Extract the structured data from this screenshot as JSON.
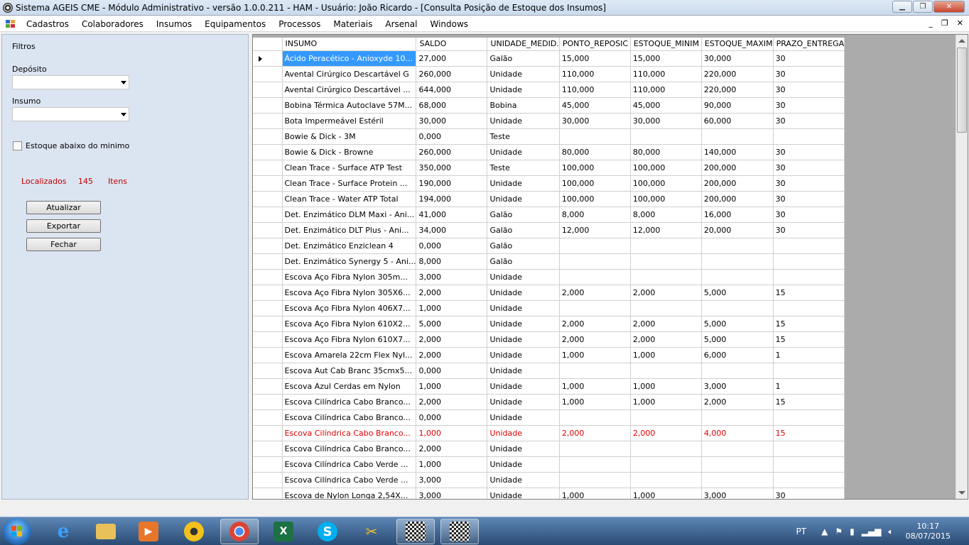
{
  "window": {
    "title": "Sistema AGEIS CME - Módulo Administrativo - versão 1.0.0.211 - HAM - Usuário: João Ricardo - [Consulta Posição de Estoque dos Insumos]",
    "min_icon": "minimize-icon",
    "max_icon": "restore-icon",
    "close_icon": "close-icon"
  },
  "menu": [
    "Cadastros",
    "Colaboradores",
    "Insumos",
    "Equipamentos",
    "Processos",
    "Materiais",
    "Arsenal",
    "Windows"
  ],
  "mdi_controls": [
    "_",
    "❐",
    "✕"
  ],
  "filters": {
    "title": "Filtros",
    "deposito_label": "Depósito",
    "deposito_value": "",
    "insumo_label": "Insumo",
    "insumo_value": "",
    "below_min_label": "Estoque abaixo do minimo",
    "below_min_checked": false,
    "found_label": "Localizados",
    "found_count": "145",
    "found_unit": "Itens",
    "buttons": {
      "update": "Atualizar",
      "export": "Exportar",
      "close": "Fechar"
    }
  },
  "grid": {
    "columns": [
      "INSUMO",
      "SALDO",
      "UNIDADE_MEDID.",
      "PONTO_REPOSIC",
      "ESTOQUE_MINIM",
      "ESTOQUE_MAXIM",
      "PRAZO_ENTREGA"
    ],
    "selected_row": 0,
    "highlight_color": "#e00000",
    "rows": [
      {
        "c": [
          "Ácido Peracético - Anioxyde 10...",
          "27,000",
          "Galão",
          "15,000",
          "15,000",
          "30,000",
          "30"
        ],
        "warn": false
      },
      {
        "c": [
          "Avental Cirúrgico Descartável  G",
          "260,000",
          "Unidade",
          "110,000",
          "110,000",
          "220,000",
          "30"
        ],
        "warn": false
      },
      {
        "c": [
          "Avental Cirúrgico Descartável ...",
          "644,000",
          "Unidade",
          "110,000",
          "110,000",
          "220,000",
          "30"
        ],
        "warn": false
      },
      {
        "c": [
          "Bobina Térmica Autoclave 57M...",
          "68,000",
          "Bobina",
          "45,000",
          "45,000",
          "90,000",
          "30"
        ],
        "warn": false
      },
      {
        "c": [
          "Bota Impermeável Estéril",
          "30,000",
          "Unidade",
          "30,000",
          "30,000",
          "60,000",
          "30"
        ],
        "warn": false
      },
      {
        "c": [
          "Bowie & Dick - 3M",
          "0,000",
          "Teste",
          "",
          "",
          "",
          ""
        ],
        "warn": false
      },
      {
        "c": [
          "Bowie & Dick - Browne",
          "260,000",
          "Unidade",
          "80,000",
          "80,000",
          "140,000",
          "30"
        ],
        "warn": false
      },
      {
        "c": [
          "Clean Trace - Surface ATP Test",
          "350,000",
          "Teste",
          "100,000",
          "100,000",
          "200,000",
          "30"
        ],
        "warn": false
      },
      {
        "c": [
          "Clean Trace - Surface Protein ...",
          "190,000",
          "Unidade",
          "100,000",
          "100,000",
          "200,000",
          "30"
        ],
        "warn": false
      },
      {
        "c": [
          "Clean Trace - Water ATP Total",
          "194,000",
          "Unidade",
          "100,000",
          "100,000",
          "200,000",
          "30"
        ],
        "warn": false
      },
      {
        "c": [
          "Det. Enzimático DLM Maxi - Ani...",
          "41,000",
          "Galão",
          "8,000",
          "8,000",
          "16,000",
          "30"
        ],
        "warn": false
      },
      {
        "c": [
          "Det. Enzimático DLT Plus - Ani...",
          "34,000",
          "Galão",
          "12,000",
          "12,000",
          "20,000",
          "30"
        ],
        "warn": false
      },
      {
        "c": [
          "Det. Enzimático Enziclean 4",
          "0,000",
          "Galão",
          "",
          "",
          "",
          ""
        ],
        "warn": false
      },
      {
        "c": [
          "Det. Enzimático Synergy 5 - Ani...",
          "8,000",
          "Galão",
          "",
          "",
          "",
          ""
        ],
        "warn": false
      },
      {
        "c": [
          "Escova Aço Fibra Nylon 305m...",
          "3,000",
          "Unidade",
          "",
          "",
          "",
          ""
        ],
        "warn": false
      },
      {
        "c": [
          "Escova Aço Fibra Nylon 305X6...",
          "2,000",
          "Unidade",
          "2,000",
          "2,000",
          "5,000",
          "15"
        ],
        "warn": false
      },
      {
        "c": [
          "Escova Aço Fibra Nylon 406X7...",
          "1,000",
          "Unidade",
          "",
          "",
          "",
          ""
        ],
        "warn": false
      },
      {
        "c": [
          "Escova Aço Fibra Nylon 610X2...",
          "5,000",
          "Unidade",
          "2,000",
          "2,000",
          "5,000",
          "15"
        ],
        "warn": false
      },
      {
        "c": [
          "Escova Aço Fibra Nylon 610X7...",
          "2,000",
          "Unidade",
          "2,000",
          "2,000",
          "5,000",
          "15"
        ],
        "warn": false
      },
      {
        "c": [
          "Escova Amarela 22cm Flex Nyl...",
          "2,000",
          "Unidade",
          "1,000",
          "1,000",
          "6,000",
          "1"
        ],
        "warn": false
      },
      {
        "c": [
          "Escova Aut Cab Branc 35cmx5...",
          "0,000",
          "Unidade",
          "",
          "",
          "",
          ""
        ],
        "warn": false
      },
      {
        "c": [
          "Escova Azul Cerdas em Nylon",
          "1,000",
          "Unidade",
          "1,000",
          "1,000",
          "3,000",
          "1"
        ],
        "warn": false
      },
      {
        "c": [
          "Escova Cilíndrica Cabo Branco...",
          "2,000",
          "Unidade",
          "1,000",
          "1,000",
          "2,000",
          "15"
        ],
        "warn": false
      },
      {
        "c": [
          "Escova Cilíndrica Cabo Branco...",
          "0,000",
          "Unidade",
          "",
          "",
          "",
          ""
        ],
        "warn": false
      },
      {
        "c": [
          "Escova Cilíndrica Cabo Branco...",
          "1,000",
          "Unidade",
          "2,000",
          "2,000",
          "4,000",
          "15"
        ],
        "warn": true
      },
      {
        "c": [
          "Escova Cilíndrica Cabo Branco...",
          "2,000",
          "Unidade",
          "",
          "",
          "",
          ""
        ],
        "warn": false
      },
      {
        "c": [
          "Escova Cilíndrica Cabo Verde ...",
          "1,000",
          "Unidade",
          "",
          "",
          "",
          ""
        ],
        "warn": false
      },
      {
        "c": [
          "Escova Cilíndrica Cabo Verde ...",
          "3,000",
          "Unidade",
          "",
          "",
          "",
          ""
        ],
        "warn": false
      },
      {
        "c": [
          "Escova de Nylon Longa 2,54X...",
          "3,000",
          "Unidade",
          "1,000",
          "1,000",
          "3,000",
          "30"
        ],
        "warn": false
      }
    ]
  },
  "taskbar": {
    "apps": [
      "internet-explorer-icon",
      "file-explorer-icon",
      "media-player-icon",
      "media-center-icon",
      "chrome-icon",
      "excel-icon",
      "skype-icon",
      "tools-icon",
      "ageis-app-icon",
      "ageis-app-icon-2"
    ],
    "language": "PT",
    "time": "10:17",
    "date": "08/07/2015"
  }
}
